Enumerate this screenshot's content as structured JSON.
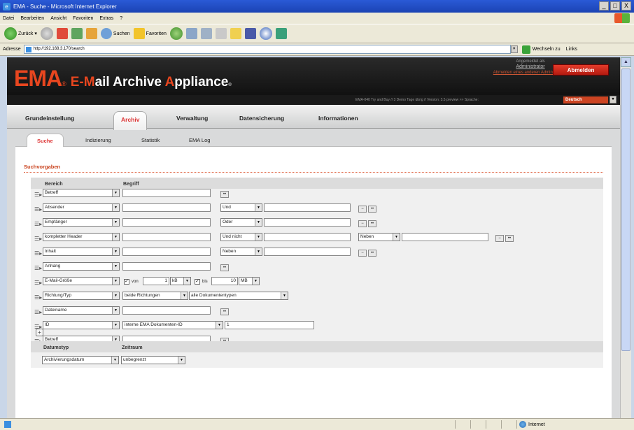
{
  "window": {
    "title": "EMA - Suche - Microsoft Internet Explorer",
    "controls": [
      "_",
      "□",
      "X"
    ]
  },
  "menu": [
    "Datei",
    "Bearbeiten",
    "Ansicht",
    "Favoriten",
    "Extras",
    "?"
  ],
  "toolbar": {
    "back": "Zurück",
    "search": "Suchen",
    "favorites": "Favoriten"
  },
  "address": {
    "label": "Adresse",
    "url": "http://192.168.3.170/search",
    "go": "Wechseln zu",
    "links": "Links"
  },
  "ema": {
    "logo": "EMA",
    "subtitle_parts": [
      "E-",
      "M",
      "ail Archive ",
      "A",
      "ppliance"
    ],
    "reg": "®",
    "logged_in_as": "Angemeldet als",
    "user": "Administrator",
    "change_password": "Abmelden eines anderen Administrators",
    "logout": "Abmelden",
    "info": "EMA-040 Try and Buy // 3 Demo Tage übrig // Version: 3.5 preview >> Sprache:",
    "language": "Deutsch"
  },
  "main_tabs": [
    "Grundeinstellung",
    "Archiv",
    "Verwaltung",
    "Datensicherung",
    "Informationen"
  ],
  "sub_tabs": [
    "Suche",
    "Indizierung",
    "Statistik",
    "EMA Log"
  ],
  "section_title": "Suchvorgaben",
  "headers": {
    "bereich": "Bereich",
    "begriff": "Begriff",
    "datumstyp": "Datumstyp",
    "zeitraum": "Zeitraum"
  },
  "rows": [
    {
      "field": "Betreff"
    },
    {
      "field": "Absender",
      "op": "Und"
    },
    {
      "field": "Empfänger",
      "op": "Oder"
    },
    {
      "field": "kompletter Header",
      "op": "Und nicht",
      "op2": "Neben"
    },
    {
      "field": "Inhalt",
      "op": "Neben"
    },
    {
      "field": "Anhang"
    },
    {
      "field": "E-Mail-Größe",
      "von_label": "von",
      "von_value": "1",
      "von_unit": "kB",
      "bis_label": "bis",
      "bis_value": "10",
      "bis_unit": "MB"
    },
    {
      "field": "Richtung/Typ",
      "dir": "beide Richtungen",
      "doc": "alle Dokumententypen"
    },
    {
      "field": "Dateiname"
    },
    {
      "field": "ID",
      "id_type": "interne EMA Dokumenten-ID",
      "id_value": "1"
    },
    {
      "field": "Betreff"
    }
  ],
  "bottom": {
    "datumstyp": "Archivierungsdatum",
    "zeitraum": "unbegrenzt"
  },
  "icons": {
    "minus": "⊟",
    "plus": "+"
  },
  "status": {
    "zone": "Internet"
  }
}
